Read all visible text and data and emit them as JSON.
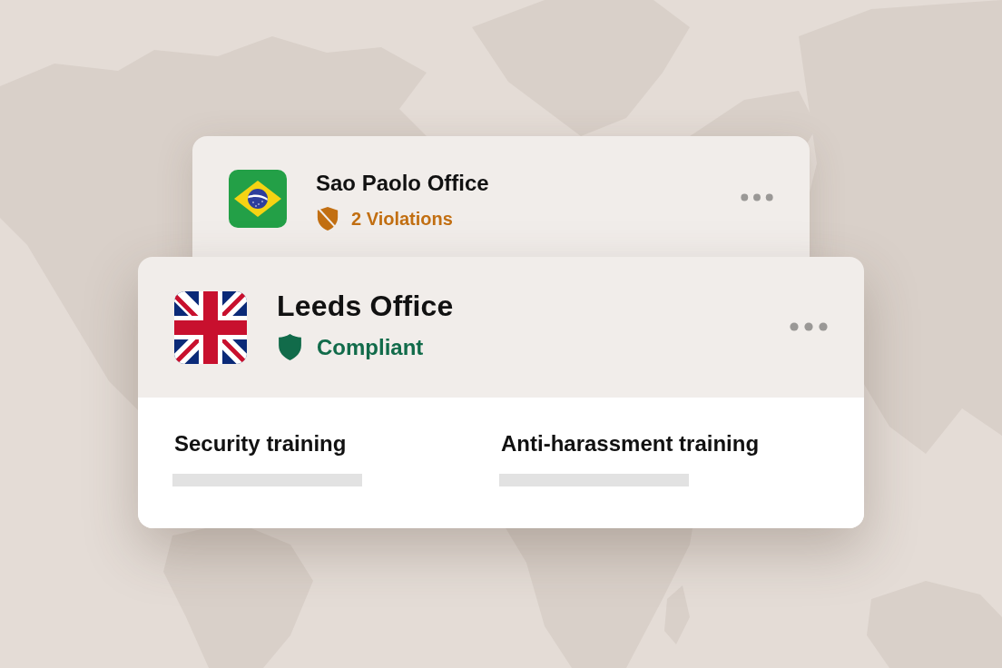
{
  "offices": [
    {
      "name": "Sao Paolo Office",
      "flag": {
        "kind": "brazil"
      },
      "status": {
        "kind": "violations",
        "label": "2 Violations"
      }
    },
    {
      "name": "Leeds Office",
      "flag": {
        "kind": "uk"
      },
      "status": {
        "kind": "compliant",
        "label": "Compliant"
      },
      "trainings": [
        {
          "label": "Security training"
        },
        {
          "label": "Anti-harassment training"
        }
      ]
    }
  ]
}
